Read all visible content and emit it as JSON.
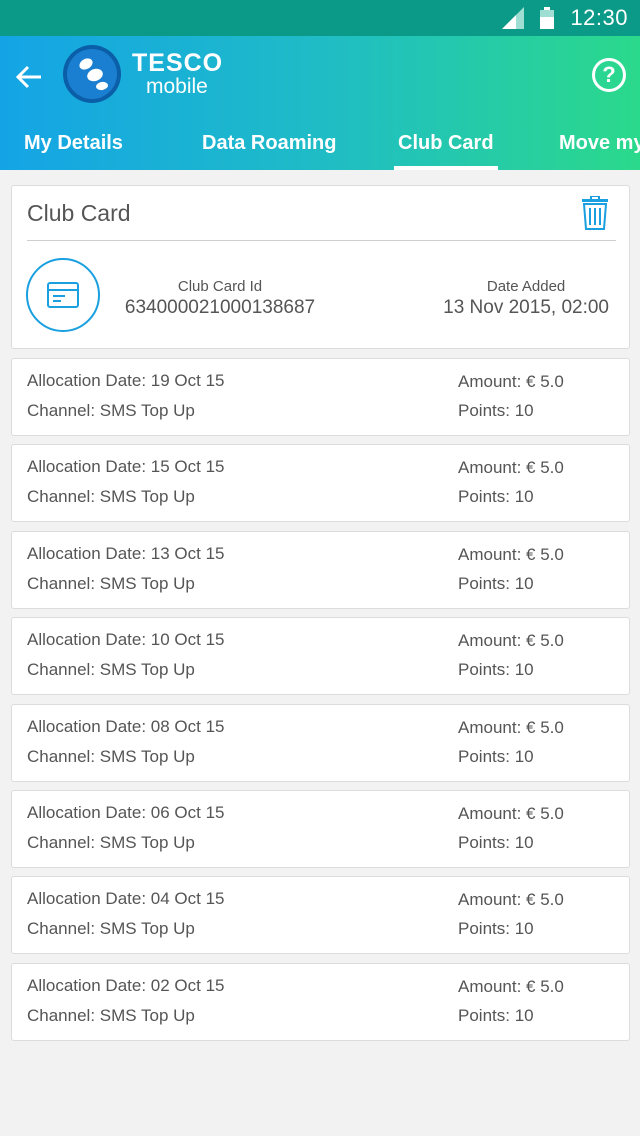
{
  "status_bar": {
    "time": "12:30"
  },
  "header": {
    "logo_brand": "TESCO",
    "logo_sub": "mobile",
    "help_label": "?",
    "colors": {
      "start": "#14a4e6",
      "end": "#2bd98b"
    }
  },
  "tabs": [
    {
      "label": "My Details",
      "active": false
    },
    {
      "label": "Data Roaming",
      "active": false
    },
    {
      "label": "Club Card",
      "active": true
    },
    {
      "label": "Move my",
      "active": false
    }
  ],
  "club_card": {
    "title": "Club Card",
    "id_label": "Club Card Id",
    "id_value": "634000021000138687",
    "date_label": "Date Added",
    "date_value": "13 Nov 2015, 02:00",
    "accent": "#1aa0e0"
  },
  "allocations": [
    {
      "date": "Allocation Date: 19 Oct 15",
      "channel": "Channel: SMS Top Up",
      "amount": "Amount: € 5.0",
      "points": "Points: 10"
    },
    {
      "date": "Allocation Date: 15 Oct 15",
      "channel": "Channel: SMS Top Up",
      "amount": "Amount: € 5.0",
      "points": "Points: 10"
    },
    {
      "date": "Allocation Date: 13 Oct 15",
      "channel": "Channel: SMS Top Up",
      "amount": "Amount: € 5.0",
      "points": "Points: 10"
    },
    {
      "date": "Allocation Date: 10 Oct 15",
      "channel": "Channel: SMS Top Up",
      "amount": "Amount: € 5.0",
      "points": "Points: 10"
    },
    {
      "date": "Allocation Date: 08 Oct 15",
      "channel": "Channel: SMS Top Up",
      "amount": "Amount: € 5.0",
      "points": "Points: 10"
    },
    {
      "date": "Allocation Date: 06 Oct 15",
      "channel": "Channel: SMS Top Up",
      "amount": "Amount: € 5.0",
      "points": "Points: 10"
    },
    {
      "date": "Allocation Date: 04 Oct 15",
      "channel": "Channel: SMS Top Up",
      "amount": "Amount: € 5.0",
      "points": "Points: 10"
    },
    {
      "date": "Allocation Date: 02 Oct 15",
      "channel": "Channel: SMS Top Up",
      "amount": "Amount: € 5.0",
      "points": "Points: 10"
    }
  ]
}
